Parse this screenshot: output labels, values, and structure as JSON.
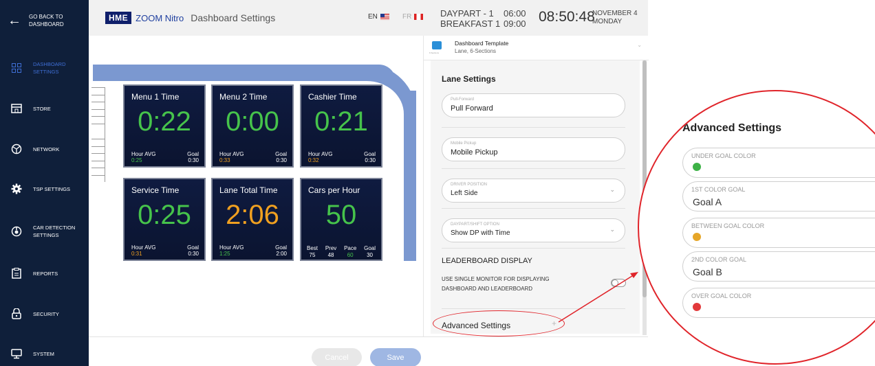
{
  "sidebar": {
    "back_label_1": "GO BACK TO",
    "back_label_2": "DASHBOARD",
    "items": [
      {
        "label_1": "DASHBOARD",
        "label_2": "SETTINGS",
        "icon": "grid-icon",
        "active": true
      },
      {
        "label_1": "STORE",
        "label_2": "",
        "icon": "store-icon"
      },
      {
        "label_1": "NETWORK",
        "label_2": "",
        "icon": "network-icon"
      },
      {
        "label_1": "TSP SETTINGS",
        "label_2": "",
        "icon": "gear-icon"
      },
      {
        "label_1": "CAR DETECTION",
        "label_2": "SETTINGS",
        "icon": "car-detection-icon"
      },
      {
        "label_1": "REPORTS",
        "label_2": "",
        "icon": "clipboard-icon"
      },
      {
        "label_1": "SECURITY",
        "label_2": "",
        "icon": "lock-icon"
      },
      {
        "label_1": "SYSTEM",
        "label_2": "",
        "icon": "monitor-icon"
      }
    ]
  },
  "header": {
    "brand": "HME",
    "product": "ZOOM Nitro",
    "title": "Dashboard Settings",
    "lang_en": "EN",
    "lang_fr": "FR",
    "daypart_1": "DAYPART - 1",
    "daypart_2": "BREAKFAST 1",
    "time_start": "06:00",
    "time_end": "09:00",
    "clock": "08:50:48",
    "date_1": "NOVEMBER 4",
    "date_2": "MONDAY"
  },
  "tiles": [
    {
      "name": "Menu 1 Time",
      "value": "0:22",
      "value_color": "green",
      "avg_label": "Hour AVG",
      "avg": "0:25",
      "avg_color": "green",
      "goal_label": "Goal",
      "goal": "0:30"
    },
    {
      "name": "Menu 2 Time",
      "value": "0:00",
      "value_color": "green",
      "avg_label": "Hour AVG",
      "avg": "0:33",
      "avg_color": "orange",
      "goal_label": "Goal",
      "goal": "0:30"
    },
    {
      "name": "Cashier Time",
      "value": "0:21",
      "value_color": "green",
      "avg_label": "Hour AVG",
      "avg": "0:32",
      "avg_color": "orange",
      "goal_label": "Goal",
      "goal": "0:30"
    },
    {
      "name": "Service Time",
      "value": "0:25",
      "value_color": "green",
      "avg_label": "Hour AVG",
      "avg": "0:31",
      "avg_color": "orange",
      "goal_label": "Goal",
      "goal": "0:30"
    },
    {
      "name": "Lane Total Time",
      "value": "2:06",
      "value_color": "orange",
      "avg_label": "Hour AVG",
      "avg": "1:25",
      "avg_color": "green",
      "goal_label": "Goal",
      "goal": "2:00"
    }
  ],
  "cph_tile": {
    "name": "Cars per Hour",
    "value": "50",
    "labels": [
      "Best",
      "Prev",
      "Pace",
      "Goal"
    ],
    "values": [
      "75",
      "48",
      "60",
      "30"
    ]
  },
  "footer": {
    "cancel": "Cancel",
    "save": "Save"
  },
  "panel": {
    "template_title": "Dashboard Template",
    "template_sub": "Lane, 6-Sections",
    "template_icon_text": "6 Sections",
    "lane_settings": "Lane Settings",
    "pull_forward_label": "Pull-Forward",
    "pull_forward_value": "Pull Forward",
    "mobile_pickup_label": "Mobile Pickup",
    "mobile_pickup_value": "Mobile Pickup",
    "driver_label": "DRIVER POSITION",
    "driver_value": "Left Side",
    "daypart_label": "DAYPART/SHIFT OPTION",
    "daypart_value": "Show DP with Time",
    "leaderboard_title": "LEADERBOARD DISPLAY",
    "leaderboard_text_1": "USE SINGLE MONITOR FOR DISPLAYING",
    "leaderboard_text_2": "DASHBOARD AND LEADERBOARD",
    "advanced": "Advanced Settings",
    "plus": "+"
  },
  "zoom": {
    "title": "Advanced Settings",
    "fields": [
      {
        "label": "UNDER GOAL COLOR",
        "value": "",
        "dot": "#3db246"
      },
      {
        "label": "1ST COLOR GOAL",
        "value": "Goal A",
        "dot": ""
      },
      {
        "label": "BETWEEN GOAL COLOR",
        "value": "",
        "dot": "#e6a628"
      },
      {
        "label": "2ND COLOR GOAL",
        "value": "Goal B",
        "dot": ""
      },
      {
        "label": "OVER GOAL COLOR",
        "value": "",
        "dot": "#e2393b"
      }
    ]
  },
  "colors": {
    "sidebar": "#0f1f3a",
    "accent": "#3f6fd6",
    "annotation": "#e0242a",
    "green": "#46c34b",
    "orange": "#f0a020"
  }
}
